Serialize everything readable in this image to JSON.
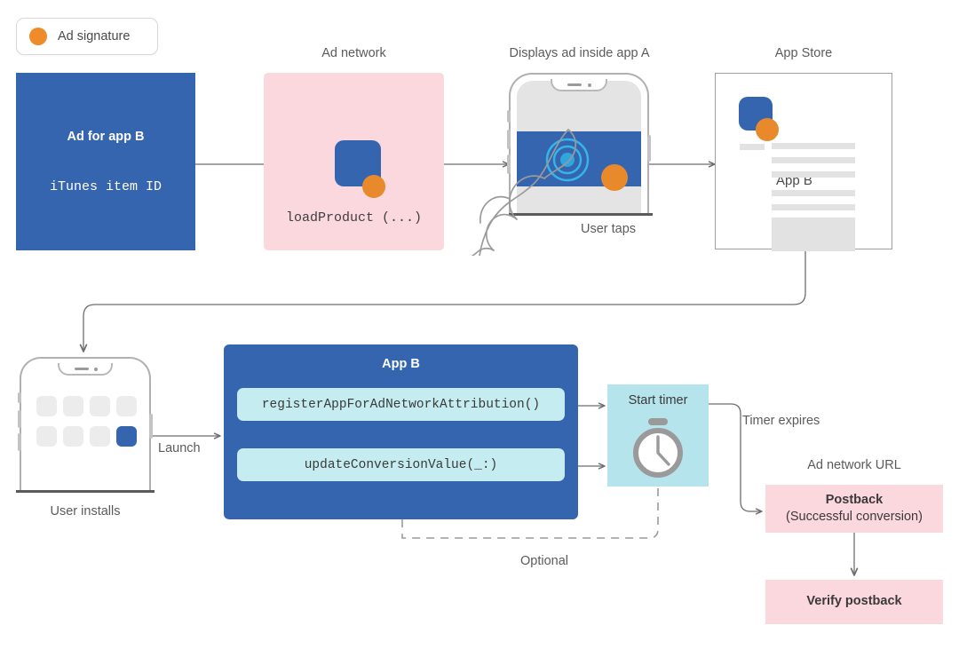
{
  "legend": {
    "label": "Ad signature",
    "dot_color": "#ef8b28"
  },
  "colors": {
    "blue": "#3665b0",
    "pink": "#fbd7de",
    "cyan": "#b5e4ec",
    "code_pill": "#c5ecf1",
    "orange": "#e8892b",
    "gray_line": "#6e6e6e",
    "skeleton": "#e2e2e2"
  },
  "top_row": {
    "ad_card": {
      "title": "Ad for app B",
      "subtitle": "iTunes item ID"
    },
    "ad_network": {
      "caption": "Ad network",
      "code": "loadProduct (...)"
    },
    "display_phone": {
      "caption": "Displays ad inside app A",
      "sub_caption": "User taps"
    },
    "app_store": {
      "caption": "App Store",
      "app_label": "App B"
    }
  },
  "bottom_row": {
    "install_phone": {
      "caption": "User installs",
      "launch_label": "Launch"
    },
    "app_b": {
      "title": "App B",
      "api_calls": [
        "registerAppForAdNetworkAttribution()",
        "updateConversionValue(_:)"
      ],
      "optional_label": "Optional"
    },
    "timer": {
      "title": "Start timer",
      "expires_label": "Timer expires"
    },
    "ad_network_url": {
      "caption": "Ad network URL",
      "postback_title": "Postback",
      "postback_subtitle": "(Successful conversion)",
      "verify_title": "Verify postback"
    }
  }
}
